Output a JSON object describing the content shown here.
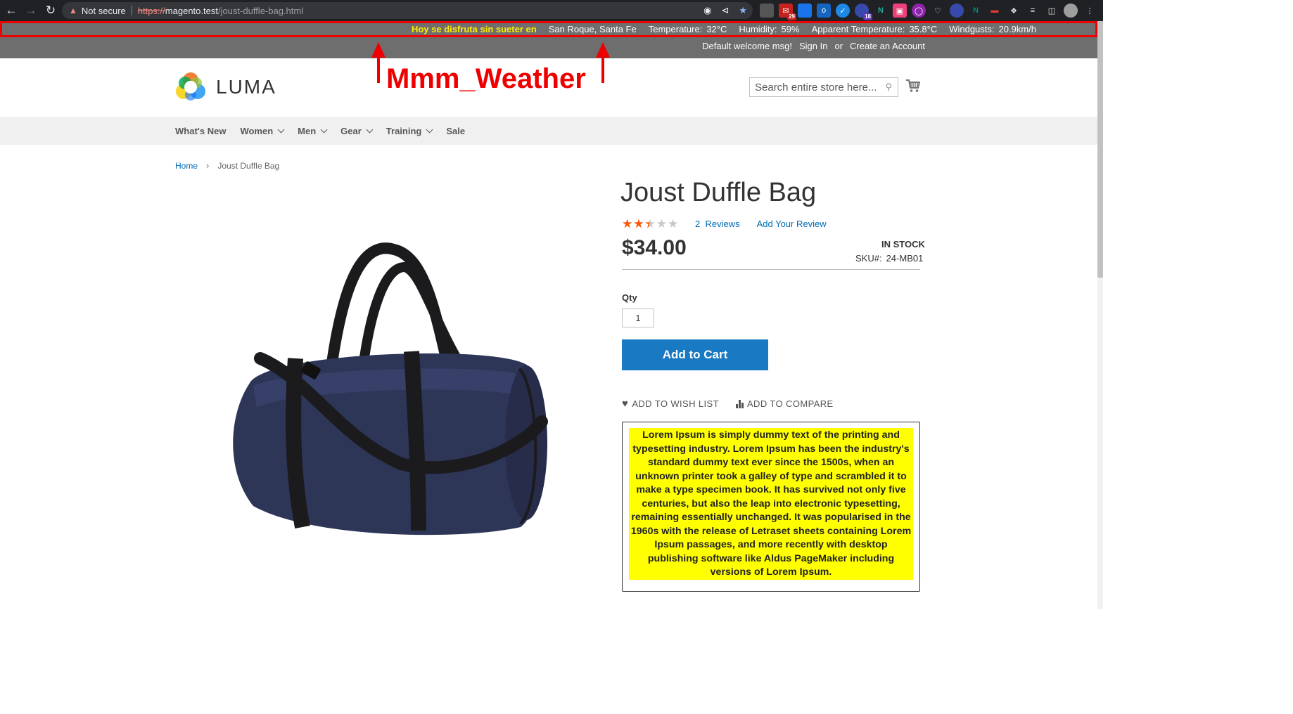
{
  "browser": {
    "not_secure": "Not secure",
    "url_scheme": "https://",
    "url_host": "magento.test",
    "url_path": "/joust-duffle-bag.html",
    "extension_badges": [
      "29",
      "18"
    ]
  },
  "weather": {
    "message": "Hoy se disfruta sin sueter en",
    "location": "San Roque, Santa Fe",
    "temperature_label": "Temperature:",
    "temperature_value": "32°C",
    "humidity_label": "Humidity:",
    "humidity_value": "59%",
    "apparent_label": "Apparent Temperature:",
    "apparent_value": "35.8°C",
    "windgusts_label": "Windgusts:",
    "windgusts_value": "20.9km/h"
  },
  "header": {
    "welcome": "Default welcome msg!",
    "sign_in": "Sign In",
    "or": "or",
    "create_account": "Create an Account"
  },
  "annotation": {
    "label": "Mmm_Weather"
  },
  "logo": {
    "text": "LUMA"
  },
  "search": {
    "placeholder": "Search entire store here..."
  },
  "nav": {
    "items": [
      {
        "label": "What's New",
        "dropdown": false
      },
      {
        "label": "Women",
        "dropdown": true
      },
      {
        "label": "Men",
        "dropdown": true
      },
      {
        "label": "Gear",
        "dropdown": true
      },
      {
        "label": "Training",
        "dropdown": true
      },
      {
        "label": "Sale",
        "dropdown": false
      }
    ]
  },
  "breadcrumbs": {
    "home": "Home",
    "current": "Joust Duffle Bag"
  },
  "product": {
    "title": "Joust Duffle Bag",
    "rating_fraction": 0.5,
    "reviews_count": "2",
    "reviews_label": "Reviews",
    "add_review": "Add Your Review",
    "price": "$34.00",
    "stock": "IN STOCK",
    "sku_label": "SKU#:",
    "sku_value": "24-MB01",
    "qty_label": "Qty",
    "qty_value": "1",
    "add_to_cart": "Add to Cart",
    "wishlist": "ADD TO WISH LIST",
    "compare": "ADD TO COMPARE",
    "description": "Lorem Ipsum is simply dummy text of the printing and typesetting industry. Lorem Ipsum has been the industry's standard dummy text ever since the 1500s, when an unknown printer took a galley of type and scrambled it to make a type specimen book. It has survived not only five centuries, but also the leap into electronic typesetting, remaining essentially unchanged. It was popularised in the 1960s with the release of Letraset sheets containing Lorem Ipsum passages, and more recently with desktop publishing software like Aldus PageMaker including versions of Lorem Ipsum."
  },
  "colors": {
    "weather_bar": "#6e6e6e",
    "weather_message": "#ffeb00",
    "annotation": "#ee0000",
    "primary_button": "#1979c3",
    "link": "#006bb4",
    "star": "#ff5501",
    "description_bg": "#ffff00"
  }
}
